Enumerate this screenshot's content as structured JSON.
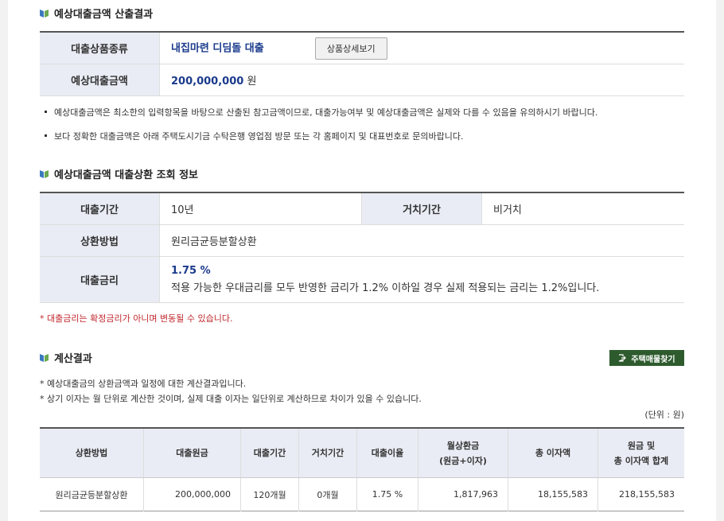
{
  "section1": {
    "title": "예상대출금액 산출결과",
    "product_label": "대출상품종류",
    "product_value": "내집마련 디딤돌 대출",
    "detail_button": "상품상세보기",
    "amount_label": "예상대출금액",
    "amount_value": "200,000,000",
    "amount_unit": "원",
    "notes": [
      "예상대출금액은 최소한의 입력항목을 바탕으로 산출된 참고금액이므로, 대출가능여부 및 예상대출금액은 실제와 다를 수 있음을 유의하시기 바랍니다.",
      "보다 정확한 대출금액은 아래 주택도시기금 수탁은행 영업점 방문 또는 각 홈페이지 및 대표번호로 문의바랍니다."
    ]
  },
  "section2": {
    "title": "예상대출금액 대출상환 조회 정보",
    "period_label": "대출기간",
    "period_value": "10년",
    "grace_label": "거치기간",
    "grace_value": "비거치",
    "method_label": "상환방법",
    "method_value": "원리금균등분할상환",
    "rate_label": "대출금리",
    "rate_value": "1.75 %",
    "rate_desc": "적용 가능한 우대금리를 모두 반영한 금리가 1.2% 이하일 경우 실제 적용되는 금리는 1.2%입니다.",
    "red_note": "* 대출금리는 확정금리가 아니며 변동될 수 있습니다."
  },
  "section3": {
    "title": "계산결과",
    "find_button": "주택매물찾기",
    "notes": [
      "* 예상대출금의 상환금액과 일정에 대한 계산결과입니다.",
      "* 상기 이자는 월 단위로 계산한 것이며, 실제 대출 이자는 일단위로 계산하므로 차이가 있을 수 있습니다."
    ],
    "unit": "(단위 : 원)",
    "headers": [
      "상환방법",
      "대출원금",
      "대출기간",
      "거치기간",
      "대출이율",
      "월상환금",
      "(원금+이자)",
      "총 이자액",
      "원금 및",
      "총 이자액 합계"
    ],
    "row": [
      "원리금균등분할상환",
      "200,000,000",
      "120개월",
      "0개월",
      "1.75 %",
      "1,817,963",
      "18,155,583",
      "218,155,583"
    ]
  }
}
